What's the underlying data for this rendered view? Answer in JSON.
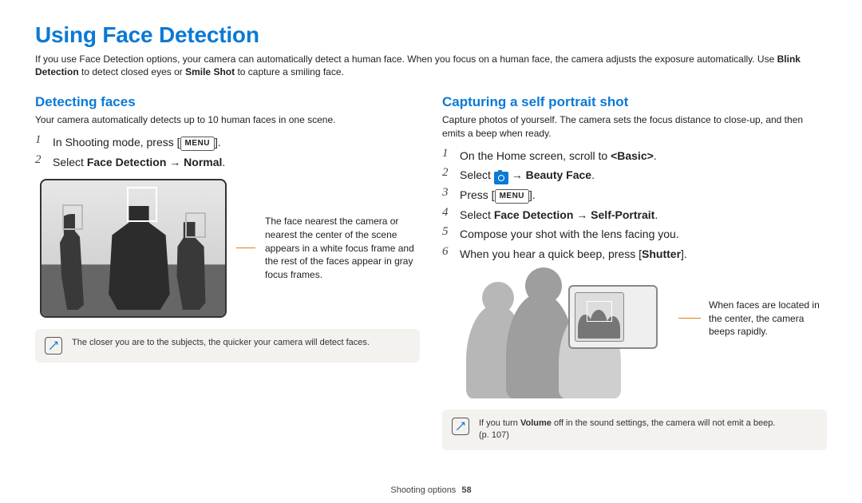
{
  "title": "Using Face Detection",
  "intro": {
    "pre": "If you use Face Detection options, your camera can automatically detect a human face. When you focus on a human face, the camera adjusts the exposure automatically. Use ",
    "bold1": "Blink Detection",
    "mid": " to detect closed eyes or ",
    "bold2": "Smile Shot",
    "post": " to capture a smiling face."
  },
  "left": {
    "heading": "Detecting faces",
    "desc": "Your camera automatically detects up to 10 human faces in one scene.",
    "steps": [
      {
        "pre": "In Shooting mode, press [",
        "menu": "MENU",
        "post": "]."
      },
      {
        "pre": "Select ",
        "bold": "Face Detection → Normal",
        "post": "."
      }
    ],
    "callout": "The face nearest the camera or nearest the center of the scene appears in a white focus frame and the rest of the faces appear in gray focus frames.",
    "tip": "The closer you are to the subjects, the quicker your camera will detect faces."
  },
  "right": {
    "heading": "Capturing a self portrait shot",
    "desc": "Capture photos of yourself. The camera sets the focus distance to close-up, and then emits a beep when ready.",
    "steps": [
      {
        "pre": "On the Home screen, scroll to ",
        "bold": "<Basic>",
        "post": "."
      },
      {
        "pre": "Select ",
        "icon": "camera",
        "mid": " → ",
        "bold": "Beauty Face",
        "post": "."
      },
      {
        "pre": "Press [",
        "menu": "MENU",
        "post": "]."
      },
      {
        "pre": "Select ",
        "bold": "Face Detection → Self-Portrait",
        "post": "."
      },
      {
        "pre": "Compose your shot with the lens facing you."
      },
      {
        "pre": "When you hear a quick beep, press [",
        "bold": "Shutter",
        "post": "]."
      }
    ],
    "callout": "When faces are located in the center, the camera beeps rapidly.",
    "tip": {
      "line1": "If you turn ",
      "bold": "Volume",
      "line2": " off in the sound settings, the camera will not emit a beep.",
      "ref": "(p. 107)"
    }
  },
  "footer": {
    "section": "Shooting options",
    "page": "58"
  }
}
